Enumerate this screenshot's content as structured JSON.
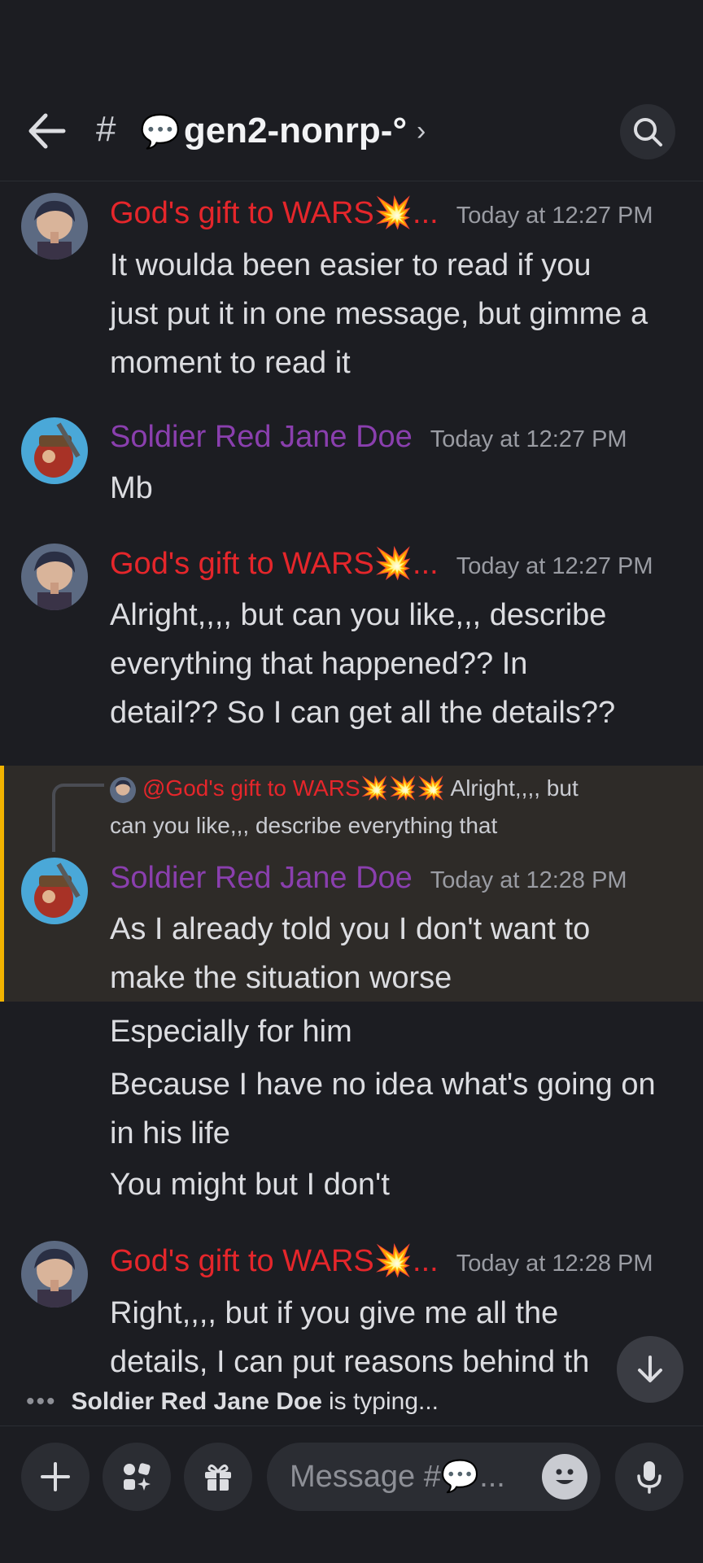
{
  "header": {
    "hash": "#",
    "channel_icon": "💬",
    "channel_name": "gen2-nonrp-°",
    "chevron": "›"
  },
  "messages": [
    {
      "author": "God's gift to WARS💥...",
      "author_color": "#e5262b",
      "time": "Today at 12:27 PM",
      "lines": [
        "It woulda been easier to read if you",
        "just put it in one message, but gimme a",
        "moment to read it"
      ]
    },
    {
      "author": "Soldier Red Jane Doe",
      "author_color": "#8a3fae",
      "time": "Today at 12:27 PM",
      "lines": [
        "Mb"
      ]
    },
    {
      "author": "God's gift to WARS💥...",
      "author_color": "#e5262b",
      "time": "Today at 12:27 PM",
      "lines": [
        "Alright,,,, but can you like,,, describe",
        "everything that happened?? In",
        "detail?? So I can get all the details??"
      ]
    },
    {
      "reply_to": "@God's gift to WARS💥💥💥",
      "reply_excerpt_1": "Alright,,,, but",
      "reply_excerpt_2": "can you like,,, describe everything that",
      "author": "Soldier Red Jane Doe",
      "author_color": "#8a3fae",
      "time": "Today at 12:28 PM",
      "lines": [
        "As I already told you I don't want to",
        "make the situation worse"
      ],
      "followups": [
        "Especially for him",
        "Because I have no idea what's going on",
        "in his life",
        "You might but I don't"
      ]
    },
    {
      "author": "God's gift to WARS💥...",
      "author_color": "#e5262b",
      "time": "Today at 12:28 PM",
      "lines": [
        "Right,,,, but if you give me all the",
        "details, I can put reasons behind th"
      ]
    }
  ],
  "typing": {
    "dots": "•••",
    "user": "Soldier Red Jane Doe",
    "suffix": "is typing..."
  },
  "composer": {
    "placeholder": "Message #💬..."
  },
  "icons": [
    "back-arrow-icon",
    "search-icon",
    "arrow-down-icon",
    "plus-icon",
    "apps-icon",
    "gift-icon",
    "emoji-icon",
    "microphone-icon"
  ]
}
